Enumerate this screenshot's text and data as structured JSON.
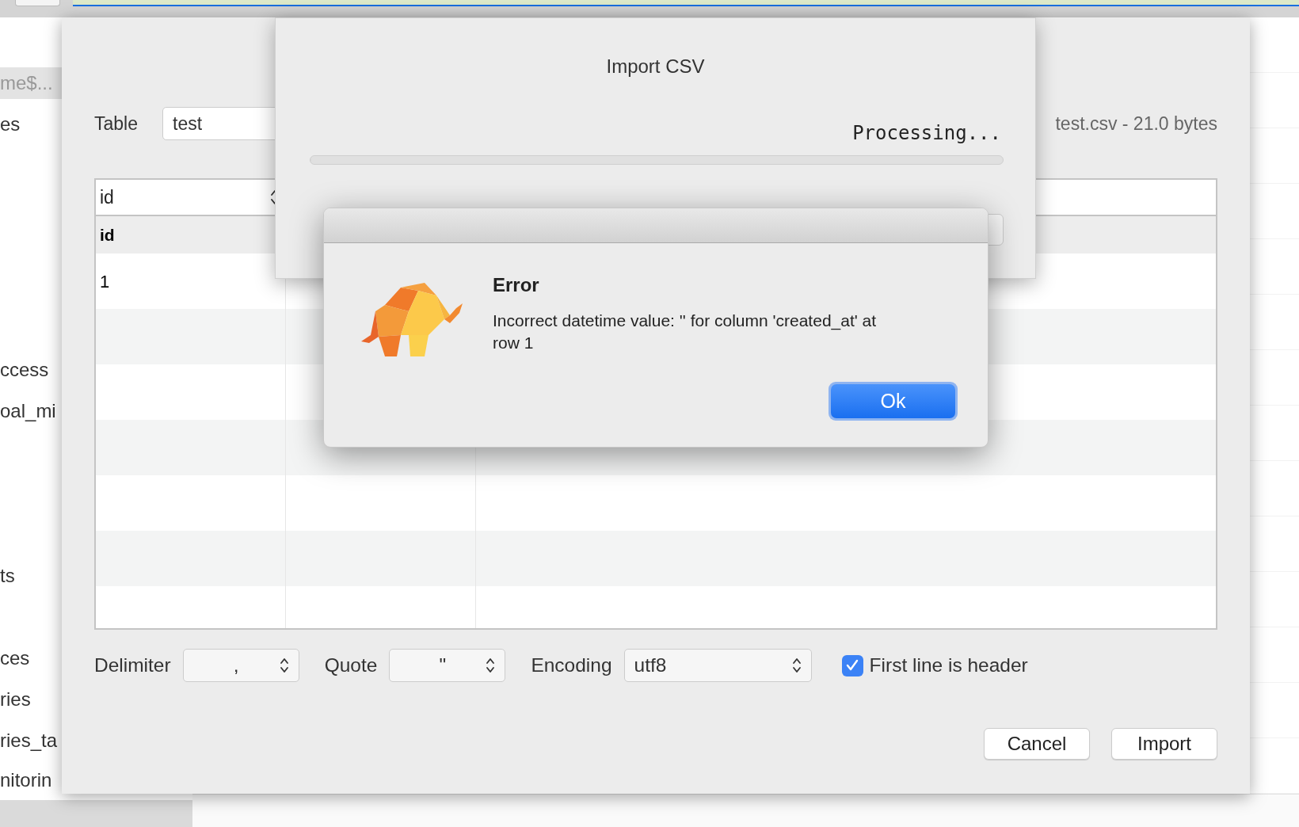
{
  "background": {
    "sidebar_items": [
      {
        "label": "me$...",
        "selected": true
      },
      {
        "label": "es",
        "selected": false
      },
      {
        "label": "ccess",
        "selected": false
      },
      {
        "label": "oal_mi",
        "selected": false
      },
      {
        "label": "ts",
        "selected": false
      },
      {
        "label": "ces",
        "selected": false
      },
      {
        "label": "ries",
        "selected": false
      },
      {
        "label": "ries_ta",
        "selected": false
      },
      {
        "label": "nitorin",
        "selected": false
      }
    ]
  },
  "import_dialog": {
    "table_label": "Table",
    "table_value": "test",
    "file_info": "test.csv - 21.0 bytes",
    "column_select": "id",
    "columns": [
      "id"
    ],
    "rows": [
      [
        "1"
      ]
    ],
    "delimiter_label": "Delimiter",
    "delimiter": ",",
    "quote_label": "Quote",
    "quote": "\"",
    "encoding_label": "Encoding",
    "encoding": "utf8",
    "first_line_header": {
      "label": "First line is header",
      "checked": true
    },
    "buttons": [
      "Cancel",
      "Import"
    ]
  },
  "progress_dialog": {
    "title": "Import CSV",
    "status": "Processing...",
    "level": 0
  },
  "error_dialog": {
    "title": "Error",
    "message": "Incorrect datetime value: '' for column 'created_at' at row 1",
    "button": "Ok"
  }
}
